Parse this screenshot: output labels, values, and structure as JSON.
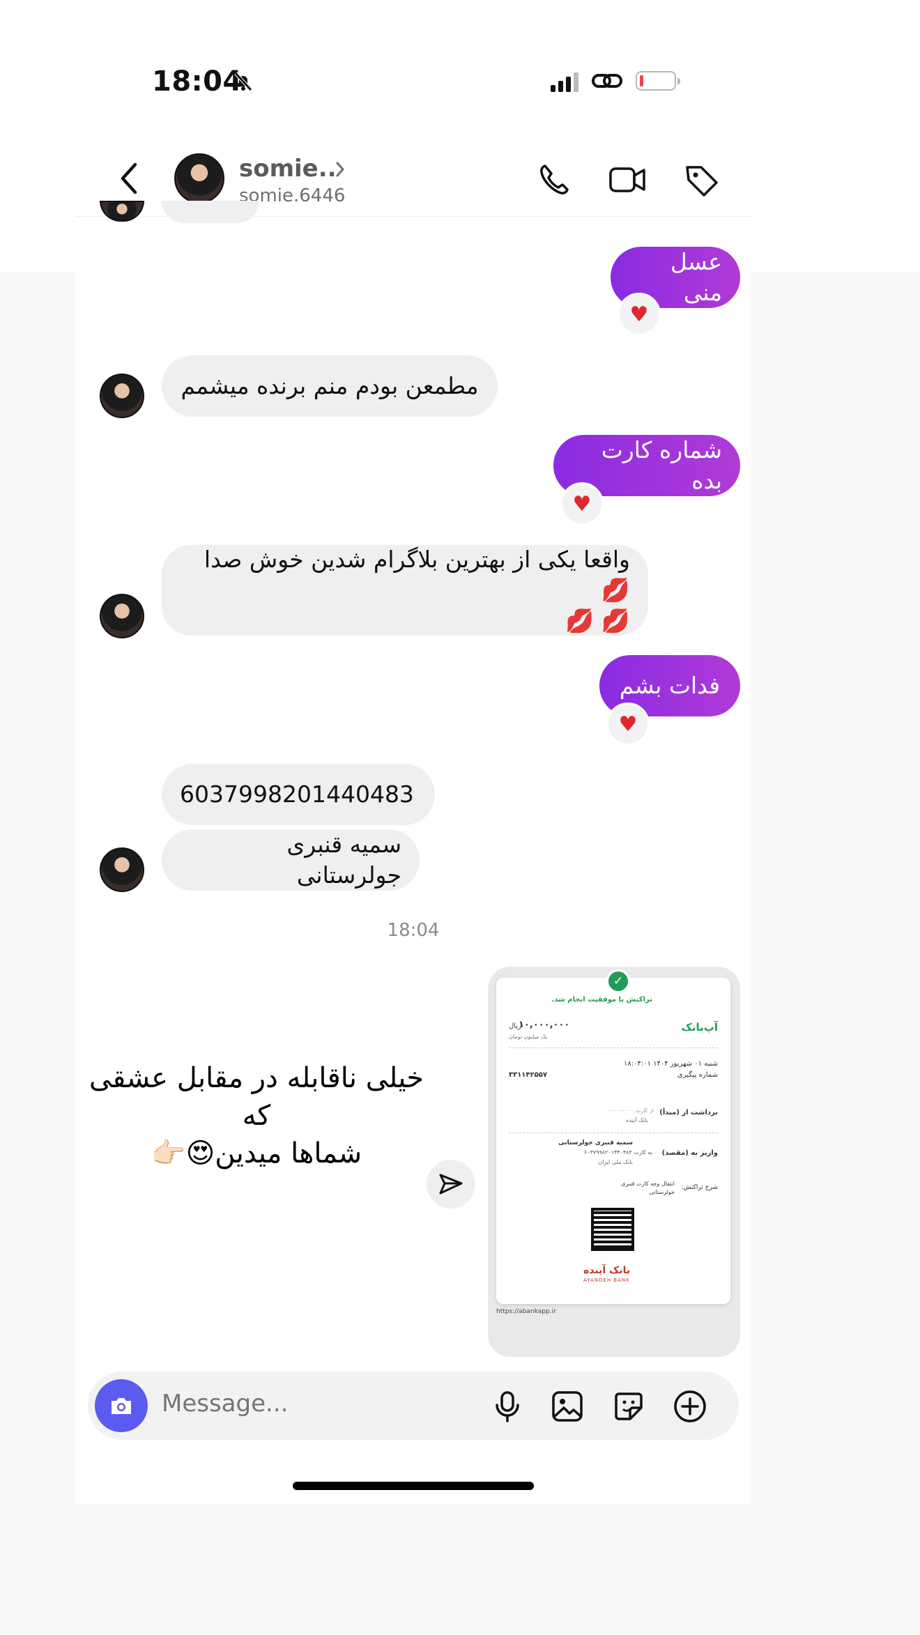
{
  "status": {
    "time": "18:04"
  },
  "header": {
    "name": "somie..",
    "handle": "somie.6446"
  },
  "messages": [
    {
      "dir": "out",
      "text": "عسل منی",
      "reaction": "♥"
    },
    {
      "dir": "in",
      "text": "مطمعن بودم منم برنده میشمم"
    },
    {
      "dir": "out",
      "text": "شماره کارت بده",
      "reaction": "♥"
    },
    {
      "dir": "in",
      "text_line1": "واقعا یکی از بهترین بلاگرام شدین خوش صدا 💋",
      "text_line2": "💋 💋"
    },
    {
      "dir": "out",
      "text": "فدات بشم",
      "reaction": "♥"
    },
    {
      "dir": "in",
      "text": "6037998201440483"
    },
    {
      "dir": "in",
      "text": "سمیه قنبری جولرستانی"
    }
  ],
  "timestamp": "18:04",
  "receipt": {
    "status_text": "تراکنش با موفقیت انجام شد.",
    "amount": "۱۰,۰۰۰,۰۰۰",
    "amount_unit": "ریال",
    "amount_words": "یک میلیون تومان",
    "bank_brand": "آپ‌بانک",
    "date": "شنبه ۰۱ شهریور ۱۴۰۴ ۱۸:۰۴:۰۱",
    "tracking_label": "شماره پیگیری",
    "tracking_number": "۳۳۱۱۴۲۵۵۷",
    "from_label": "برداشت از (مبدأ)",
    "from_bank": "بانک آینده",
    "from_card": "از کارت ۰۰۰۰-۰۰۰۰",
    "to_label": "واریز به (مقصد)",
    "to_name": "سمیه قنبری جولرستانی",
    "to_card": "به کارت ۶۰۳۷۹۹۸۲۰۱۴۴۰۴۸۳",
    "to_bank": "بانک ملی ایران",
    "desc_label": "شرح تراکنش:",
    "desc": "انتقال وجه کارت قنبری جولرستانی",
    "issuer": "بانک آینده",
    "issuer_en": "AYANDEH BANK",
    "url": "https://abankapp.ir"
  },
  "caption": {
    "line1": "خیلی ناقابله در مقابل عشقی که",
    "line2": "شماها میدین😍👉🏻"
  },
  "composer": {
    "placeholder": "Message..."
  },
  "colors": {
    "outgoing": "#9b30e0",
    "incoming": "#efeff1",
    "camera": "#5b5bf0"
  },
  "icons": [
    "back-icon",
    "call-icon",
    "video-icon",
    "tag-icon",
    "camera-icon",
    "mic-icon",
    "gallery-icon",
    "sticker-icon",
    "plus-icon",
    "share-icon",
    "heart-icon"
  ]
}
